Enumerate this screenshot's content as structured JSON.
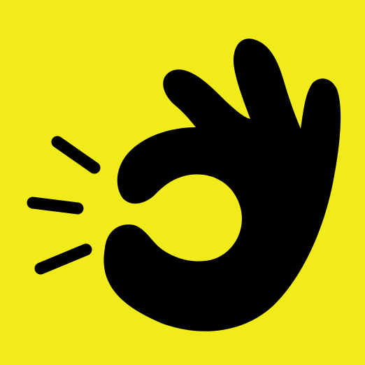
{
  "colors": {
    "background": "#F2EB1A",
    "ink": "#000000"
  },
  "icon": {
    "name": "ok-hand-gesture-icon"
  }
}
